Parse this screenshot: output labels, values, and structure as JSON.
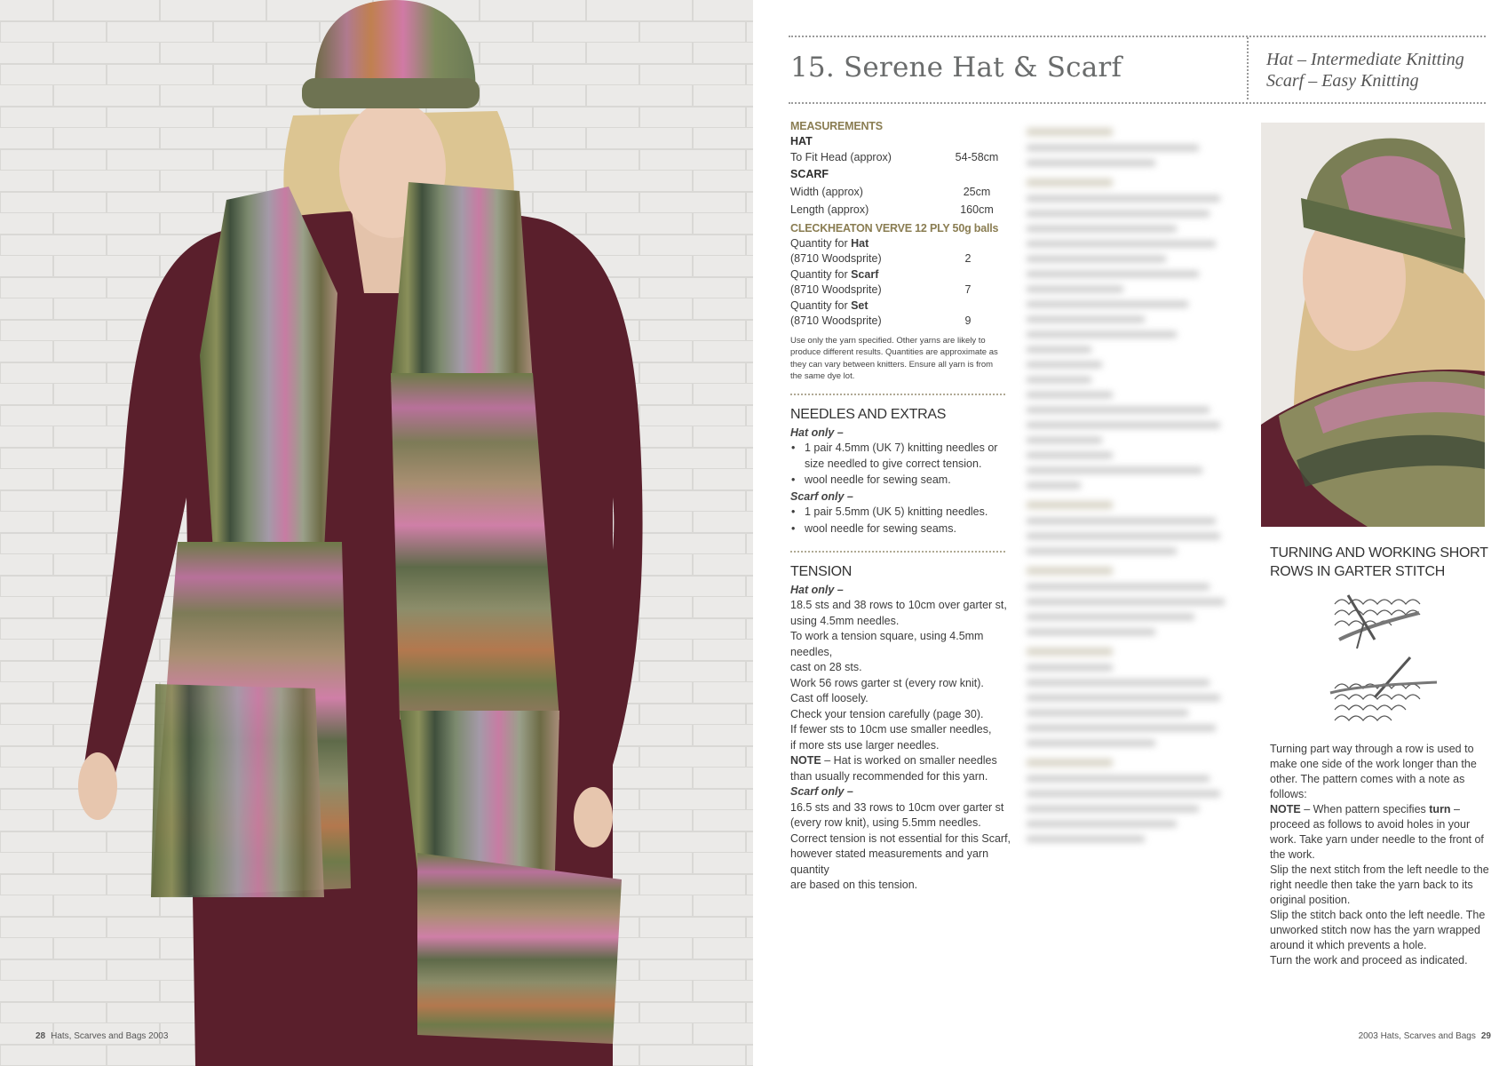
{
  "folio_left": {
    "page": "28",
    "book": "Hats, Scarves and Bags 2003"
  },
  "folio_right": {
    "page": "29",
    "book": "2003 Hats, Scarves and Bags"
  },
  "title": "15. Serene Hat & Scarf",
  "levels": [
    "Hat – Intermediate Knitting",
    "Scarf – Easy Knitting"
  ],
  "measurements": {
    "heading": "MEASUREMENTS",
    "hat_label": "HAT",
    "hat_rows": [
      {
        "label": "To Fit Head (approx)",
        "value": "54-58cm"
      }
    ],
    "scarf_label": "SCARF",
    "scarf_rows": [
      {
        "label": "Width (approx)",
        "value": "25cm"
      },
      {
        "label": "Length (approx)",
        "value": "160cm"
      }
    ]
  },
  "yarn": {
    "heading": "CLECKHEATON VERVE 12 PLY 50g balls",
    "rows": [
      {
        "prefix": "Quantity for ",
        "item": "Hat",
        "shade": "(8710 Woodsprite)",
        "qty": "2"
      },
      {
        "prefix": "Quantity for ",
        "item": "Scarf",
        "shade": "(8710 Woodsprite)",
        "qty": "7"
      },
      {
        "prefix": "Quantity for ",
        "item": "Set",
        "shade": "(8710 Woodsprite)",
        "qty": "9"
      }
    ],
    "note": "Use only the yarn specified. Other yarns are likely to produce different results. Quantities are approximate as they can vary between knitters. Ensure all yarn is from the same dye lot."
  },
  "needles": {
    "heading": "NEEDLES AND EXTRAS",
    "hat_label": "Hat only –",
    "hat_items": [
      "1 pair 4.5mm (UK 7) knitting needles or size needled to give correct tension.",
      "wool needle for sewing seam."
    ],
    "scarf_label": "Scarf only –",
    "scarf_items": [
      "1 pair 5.5mm (UK 5) knitting needles.",
      "wool needle for sewing seams."
    ]
  },
  "tension": {
    "heading": "TENSION",
    "hat_label": "Hat only –",
    "hat_lines": [
      "18.5 sts and 38 rows to 10cm over garter st,",
      "using 4.5mm needles.",
      "To work a tension square, using 4.5mm needles,",
      "cast on 28 sts.",
      "Work 56 rows garter st (every row knit).",
      "Cast off loosely.",
      "Check your tension carefully (page 30).",
      "If fewer sts to 10cm use smaller needles,",
      "if more sts use larger needles."
    ],
    "note_label": "NOTE",
    "note_text": " – Hat is worked on smaller needles than usually recommended for this yarn.",
    "scarf_label": "Scarf only –",
    "scarf_lines": [
      "16.5 sts and 33 rows to 10cm over garter st",
      "(every row knit), using 5.5mm needles.",
      "Correct tension is not essential for this Scarf,",
      "however stated measurements and yarn quantity",
      "are based on this tension."
    ]
  },
  "turning": {
    "heading": "TURNING AND WORKING SHORT ROWS IN GARTER STITCH",
    "p1": "Turning part way through a row is used to make one side of the work longer than the other. The pattern comes with a note as follows:",
    "note_label": "NOTE",
    "note_mid": " – When pattern specifies ",
    "note_bold": "turn",
    "note_end": " – proceed as follows to avoid holes in your work. Take yarn under needle to the front of the work.",
    "p2": "Slip the next stitch from the left needle to the right needle then take the yarn back to its original position.",
    "p3": "Slip the stitch back onto the left needle. The unworked stitch now has the yarn wrapped around it which prevents a hole.",
    "p4": "Turn the work and proceed as indicated."
  }
}
